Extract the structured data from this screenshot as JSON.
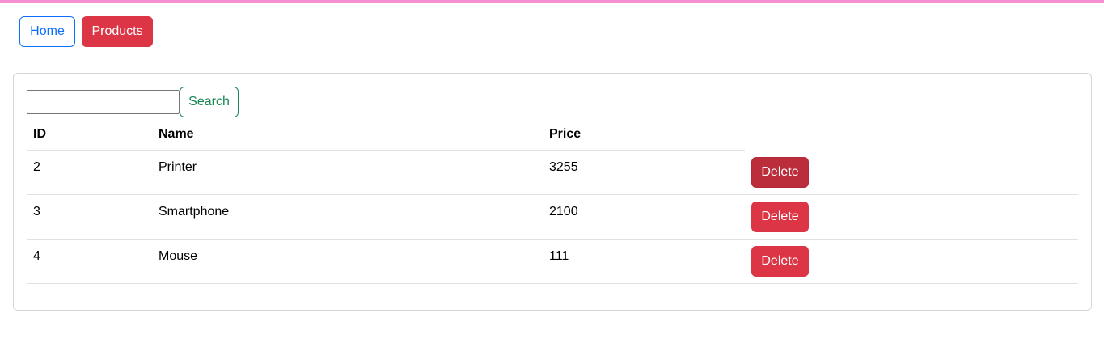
{
  "nav": {
    "home_label": "Home",
    "products_label": "Products"
  },
  "search": {
    "value": "",
    "placeholder": "",
    "button_label": "Search"
  },
  "table": {
    "headers": {
      "id": "ID",
      "name": "Name",
      "price": "Price"
    },
    "rows": [
      {
        "id": "2",
        "name": "Printer",
        "price": "3255",
        "action": "Delete"
      },
      {
        "id": "3",
        "name": "Smartphone",
        "price": "2100",
        "action": "Delete"
      },
      {
        "id": "4",
        "name": "Mouse",
        "price": "111",
        "action": "Delete"
      }
    ]
  },
  "colors": {
    "primary": "#0d6efd",
    "danger": "#dc3545",
    "danger_hover": "#bb2d3b",
    "success": "#198754",
    "top_bar": "#f48fd0"
  }
}
